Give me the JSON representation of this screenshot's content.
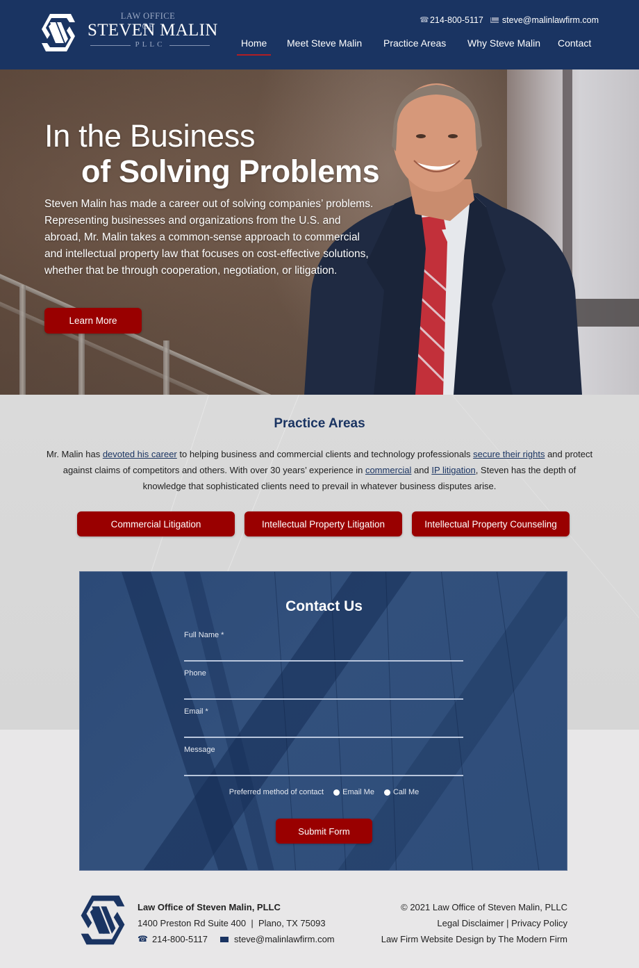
{
  "colors": {
    "navy": "#1a3462",
    "accent_red": "#990000",
    "nav_underline": "#b21e24",
    "light_gray": "#d8d8d8",
    "footer_bg": "#e8e7e8"
  },
  "header": {
    "logo": {
      "top_line": "LAW OFFICE OF",
      "name": "STEVEN MALIN",
      "sub": "PLLC",
      "icon": "s-hexagon-logo-icon"
    },
    "phone": "214-800-5117",
    "email": "steve@malinlawfirm.com",
    "phone_icon": "phone-icon",
    "email_icon": "envelope-icon",
    "nav": [
      {
        "label": "Home",
        "active": true
      },
      {
        "label": "Meet Steve Malin",
        "active": false
      },
      {
        "label": "Practice Areas",
        "active": false
      },
      {
        "label": "Why Steve Malin",
        "active": false
      },
      {
        "label": "Contact",
        "active": false
      }
    ]
  },
  "hero": {
    "title_line1": "In the Business",
    "title_line2": "of Solving Problems",
    "body": "Steven Malin has made a career out of solving companies’ problems. Representing businesses and organizations from the U.S. and abroad, Mr. Malin takes a common-sense approach to commercial and intellectual property law that focuses on cost-effective solutions, whether that be through cooperation, negotiation, or litigation.",
    "cta_label": "Learn More"
  },
  "practice": {
    "title": "Practice Areas",
    "text_parts": {
      "p1": "Mr. Malin has ",
      "link1": "devoted his career",
      "p2": " to helping business and commercial clients and technology professionals ",
      "link2": "secure their rights",
      "p3": " and protect against claims of competitors and others. With over 30 years’ experience in ",
      "link3": "commercial",
      "p4": " and ",
      "link4": "IP litigation",
      "p5": ", Steven has the depth of knowledge that sophisticated clients need to prevail in whatever business disputes arise."
    },
    "buttons": [
      {
        "label": "Commercial Litigation"
      },
      {
        "label": "Intellectual Property Litigation"
      },
      {
        "label": "Intellectual Property Counseling"
      }
    ]
  },
  "contact_form": {
    "title": "Contact Us",
    "fields": [
      {
        "label": "Full Name *",
        "value": ""
      },
      {
        "label": "Phone",
        "value": ""
      },
      {
        "label": "Email *",
        "value": ""
      },
      {
        "label": "Message",
        "value": ""
      }
    ],
    "preferred_label": "Preferred method of contact",
    "options": [
      {
        "label": "Email Me",
        "selected": false
      },
      {
        "label": "Call Me",
        "selected": false
      }
    ],
    "submit_label": "Submit Form"
  },
  "footer": {
    "firm_name": "Law Office of Steven Malin, PLLC",
    "address_line": "1400 Preston Rd Suite 400",
    "separator": "|",
    "city_line": "Plano, TX 75093",
    "phone": "214-800-5117",
    "email": "steve@malinlawfirm.com",
    "copyright": "© 2021 Law Office of Steven Malin, PLLC",
    "legal_disclaimer": "Legal Disclaimer",
    "link_sep": " | ",
    "privacy_policy": "Privacy Policy",
    "credit": "Law Firm Website Design by The Modern Firm"
  }
}
